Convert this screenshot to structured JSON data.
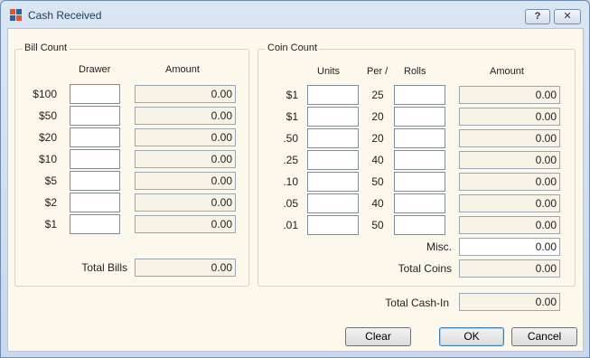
{
  "window": {
    "title": "Cash Received",
    "help_label": "?",
    "close_label": "✕"
  },
  "bill_count": {
    "group_label": "Bill Count",
    "headers": {
      "drawer": "Drawer",
      "amount": "Amount"
    },
    "rows": [
      {
        "label": "$100",
        "amount": "0.00"
      },
      {
        "label": "$50",
        "amount": "0.00"
      },
      {
        "label": "$20",
        "amount": "0.00"
      },
      {
        "label": "$10",
        "amount": "0.00"
      },
      {
        "label": "$5",
        "amount": "0.00"
      },
      {
        "label": "$2",
        "amount": "0.00"
      },
      {
        "label": "$1",
        "amount": "0.00"
      }
    ],
    "total_label": "Total Bills",
    "total_value": "0.00"
  },
  "coin_count": {
    "group_label": "Coin Count",
    "headers": {
      "units": "Units",
      "per": "Per /",
      "rolls": "Rolls",
      "amount": "Amount"
    },
    "rows": [
      {
        "label": "$1",
        "per": "25",
        "amount": "0.00"
      },
      {
        "label": "$1",
        "per": "20",
        "amount": "0.00"
      },
      {
        "label": ".50",
        "per": "20",
        "amount": "0.00"
      },
      {
        "label": ".25",
        "per": "40",
        "amount": "0.00"
      },
      {
        "label": ".10",
        "per": "50",
        "amount": "0.00"
      },
      {
        "label": ".05",
        "per": "40",
        "amount": "0.00"
      },
      {
        "label": ".01",
        "per": "50",
        "amount": "0.00"
      }
    ],
    "misc_label": "Misc.",
    "misc_value": "0.00",
    "total_label": "Total Coins",
    "total_value": "0.00"
  },
  "total_cash_in": {
    "label": "Total Cash-In",
    "value": "0.00"
  },
  "buttons": {
    "clear": "Clear",
    "ok": "OK",
    "cancel": "Cancel"
  }
}
